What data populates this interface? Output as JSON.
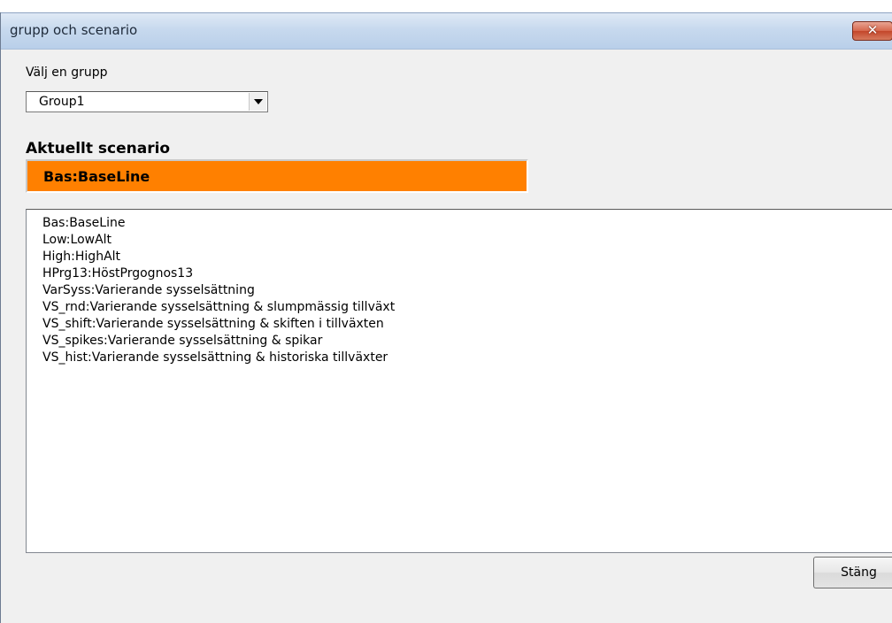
{
  "window": {
    "title": "grupp och scenario",
    "close_glyph": "✕"
  },
  "group_select": {
    "label": "Välj en grupp",
    "value": "Group1"
  },
  "current_scenario": {
    "label": "Aktuellt scenario",
    "value": "Bas:BaseLine",
    "color": "#ff8000"
  },
  "scenarios": [
    "Bas:BaseLine",
    "Low:LowAlt",
    "High:HighAlt",
    "HPrg13:HöstPrgognos13",
    "VarSyss:Varierande sysselsättning",
    "VS_rnd:Varierande sysselsättning & slumpmässig tillväxt",
    "VS_shift:Varierande sysselsättning & skiften i tillväxten",
    "VS_spikes:Varierande sysselsättning & spikar",
    "VS_hist:Varierande sysselsättning & historiska tillväxter"
  ],
  "buttons": {
    "close_label": "Stäng"
  }
}
